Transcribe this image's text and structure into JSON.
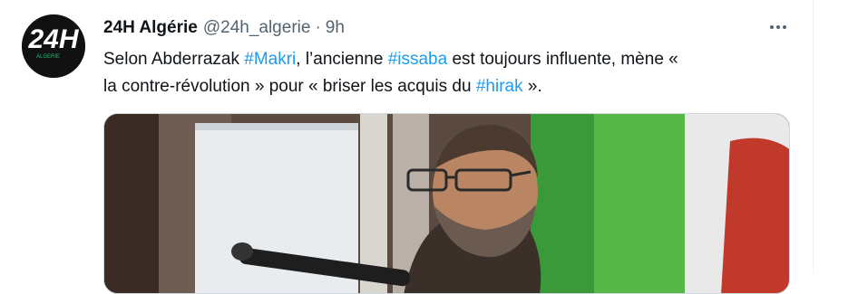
{
  "tweet": {
    "author_name": "24H Algérie",
    "author_handle": "@24h_algerie",
    "separator": "·",
    "time": "9h",
    "avatar_icon": "24h-algerie-logo",
    "avatar_text": "24H",
    "avatar_subtext": "ALGERIE",
    "more_icon": "more-dots-icon",
    "text": {
      "line1_a": "Selon Abderrazak ",
      "tag1": "#Makri",
      "line1_b": ", l’ancienne ",
      "tag2": "#issaba",
      "line1_c": " est toujours influente, mène «",
      "line2_a": "la contre-révolution » pour « briser les acquis du ",
      "tag3": "#hirak",
      "line2_b": " »."
    },
    "media_description_icon": "tweet-photo"
  },
  "colors": {
    "link": "#1d9bf0",
    "text": "#0f1419",
    "secondary": "#536471",
    "border": "#cfd9de"
  }
}
